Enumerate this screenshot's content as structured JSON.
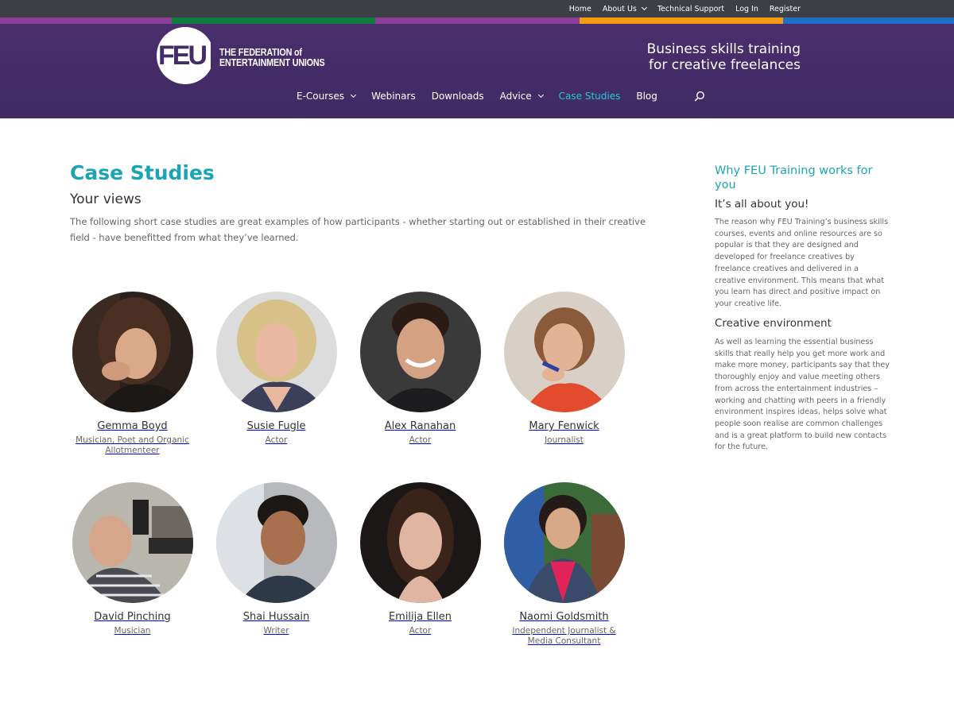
{
  "topnav": {
    "home": "Home",
    "about": "About Us",
    "support": "Technical Support",
    "login": "Log In",
    "register": "Register"
  },
  "brand": {
    "logo_mark": "FEU",
    "name_line1": "THE FEDERATION of",
    "name_line2": "ENTERTAINMENT UNIONS",
    "tagline_line1": "Business skills training",
    "tagline_line2": "for creative freelances",
    "stripe_colors": [
      "#8b3f98",
      "#0d7c3c",
      "#8b3f98",
      "#f39c12",
      "#1f6fc4"
    ],
    "header_color": "#432c67",
    "accent": "#1ca4b4"
  },
  "mainnav": {
    "ecourses": "E-Courses",
    "webinars": "Webinars",
    "downloads": "Downloads",
    "advice": "Advice",
    "case_studies": "Case Studies",
    "blog": "Blog"
  },
  "main": {
    "title": "Case Studies",
    "subtitle": "Your views",
    "intro": "The following short case studies are great examples of how participants - whether starting out or established in their creative field - have benefitted from what they’ve learned."
  },
  "people": [
    {
      "name": "Gemma Boyd",
      "role": "Musician, Poet and Organic Allotmenteer"
    },
    {
      "name": "Susie Fugle",
      "role": "Actor"
    },
    {
      "name": "Alex Ranahan",
      "role": "Actor"
    },
    {
      "name": "Mary Fenwick",
      "role": "Journalist"
    },
    {
      "name": "David Pinching",
      "role": "Musician"
    },
    {
      "name": "Shai Hussain",
      "role": "Writer"
    },
    {
      "name": "Emilija Ellen",
      "role": "Actor"
    },
    {
      "name": "Naomi Goldsmith",
      "role": "Independent Journalist & Media Consultant"
    }
  ],
  "sidebar": {
    "title": "Why FEU Training works for you",
    "h1": "It’s all about you!",
    "p1": "The reason why FEU Training’s business skills courses, events and online resources are so popular is that they are designed and developed for freelance creatives by freelance creatives and delivered in a creative environment. This means that what you learn has direct and positive impact on your creative life.",
    "h2": "Creative environment",
    "p2": "As well as learning the essential business skills that really help you get more work and make more money, participants say that they thoroughly enjoy and value meeting others from across the entertainment industries – working and chatting with peers in a friendly environment inspires ideas, helps solve what people soon realise are common challenges and is a great platform to build new contacts for the future."
  }
}
